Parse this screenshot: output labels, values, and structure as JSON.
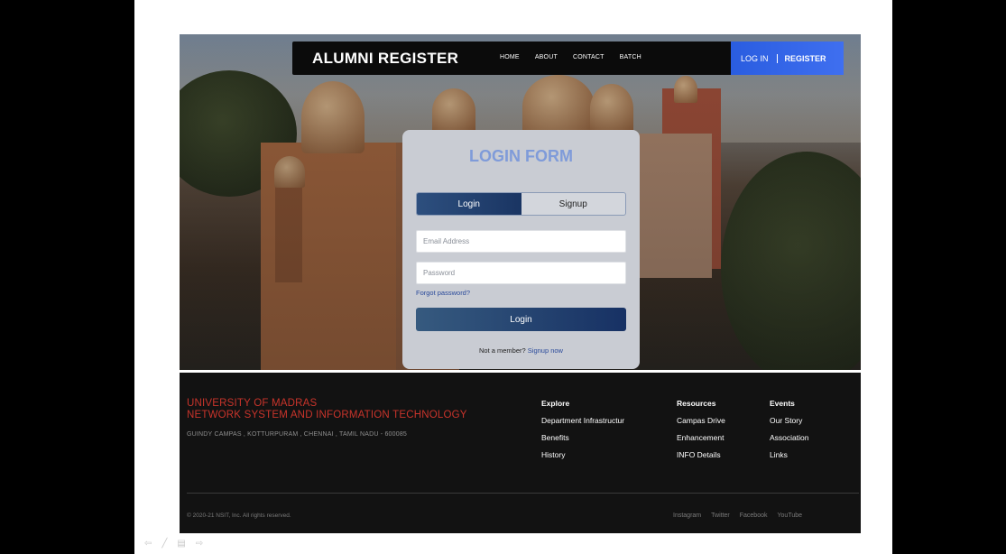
{
  "navbar": {
    "brand": "ALUMNI REGISTER",
    "links": [
      "HOME",
      "ABOUT",
      "CONTACT",
      "BATCH"
    ],
    "login": "LOG IN",
    "register": "REGISTER"
  },
  "form": {
    "title": "LOGIN FORM",
    "tab_login": "Login",
    "tab_signup": "Signup",
    "email_placeholder": "Email Address",
    "password_placeholder": "Password",
    "forgot": "Forgot password?",
    "submit": "Login",
    "member_text": "Not a member?",
    "signup_link": "Signup now"
  },
  "footer": {
    "uni_line1": "UNIVERSITY OF MADRAS",
    "uni_line2": "NETWORK SYSTEM AND INFORMATION TECHNOLOGY",
    "address": "GUINDY CAMPAS , KOTTURPURAM , CHENNAI , TAMIL NADU - 600085",
    "explore": {
      "heading": "Explore",
      "items": [
        "Department Infrastructur",
        "Benefits",
        "History"
      ]
    },
    "resources": {
      "heading": "Resources",
      "items": [
        "Campas Drive",
        "Enhancement",
        "INFO Details"
      ]
    },
    "events": {
      "heading": "Events",
      "items": [
        "Our Story",
        "Association",
        "Links"
      ]
    },
    "copyright": "© 2020-21 NSIT, Inc. All rights reserved.",
    "social": [
      "Instagram",
      "Twitter",
      "Facebook",
      "YouTube"
    ]
  },
  "controls": {
    "icons": [
      "arrow-left-icon",
      "pen-icon",
      "menu-icon",
      "arrow-right-icon"
    ],
    "glyphs": [
      "⇦",
      "╱",
      "▤",
      "⇨"
    ]
  },
  "colors": {
    "accent_blue": "#3f6ff0",
    "title_blue": "#7f9bd9",
    "footer_red": "#c9342b",
    "footer_bg": "#121212"
  }
}
